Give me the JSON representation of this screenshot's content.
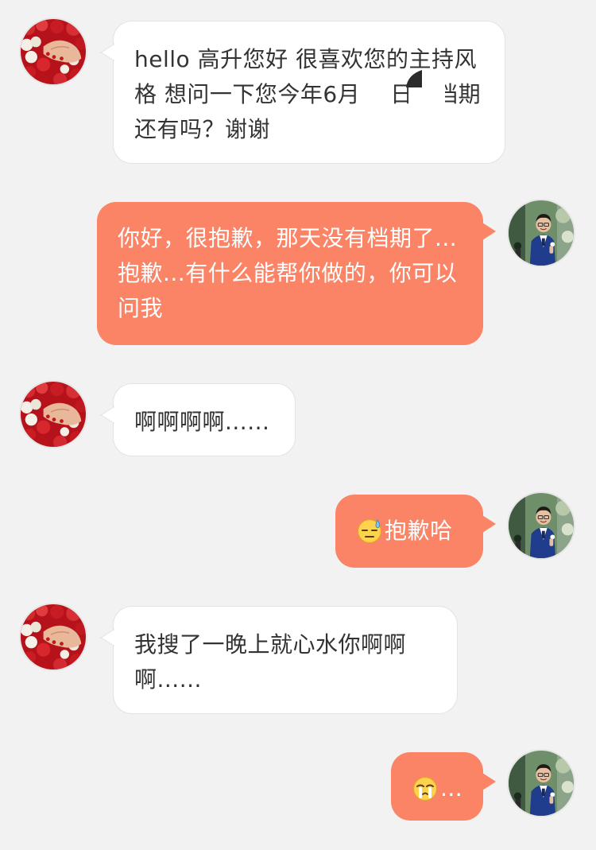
{
  "conversation": {
    "messages": [
      {
        "sender": "contact",
        "text": "hello 高升您好 很喜欢您的主持风格 想问一下您今年6月　 日的档期还有吗？谢谢"
      },
      {
        "sender": "self",
        "text": "你好，很抱歉，那天没有档期了...抱歉...有什么能帮你做的，你可以问我"
      },
      {
        "sender": "contact",
        "text": "啊啊啊啊......"
      },
      {
        "sender": "self",
        "emoji": "sweat-smile-emoji",
        "text": "抱歉哈"
      },
      {
        "sender": "contact",
        "text": "我搜了一晚上就心水你啊啊啊......"
      },
      {
        "sender": "self",
        "emoji": "crying-emoji",
        "text": "..."
      }
    ]
  },
  "avatars": {
    "contact": "hand-with-red-roses-avatar",
    "self": "man-in-blue-suit-avatar"
  },
  "colors": {
    "background": "#f2f2f2",
    "incoming_bubble": "#ffffff",
    "outgoing_bubble": "#fb8466",
    "incoming_text": "#333333",
    "outgoing_text": "#ffffff"
  }
}
